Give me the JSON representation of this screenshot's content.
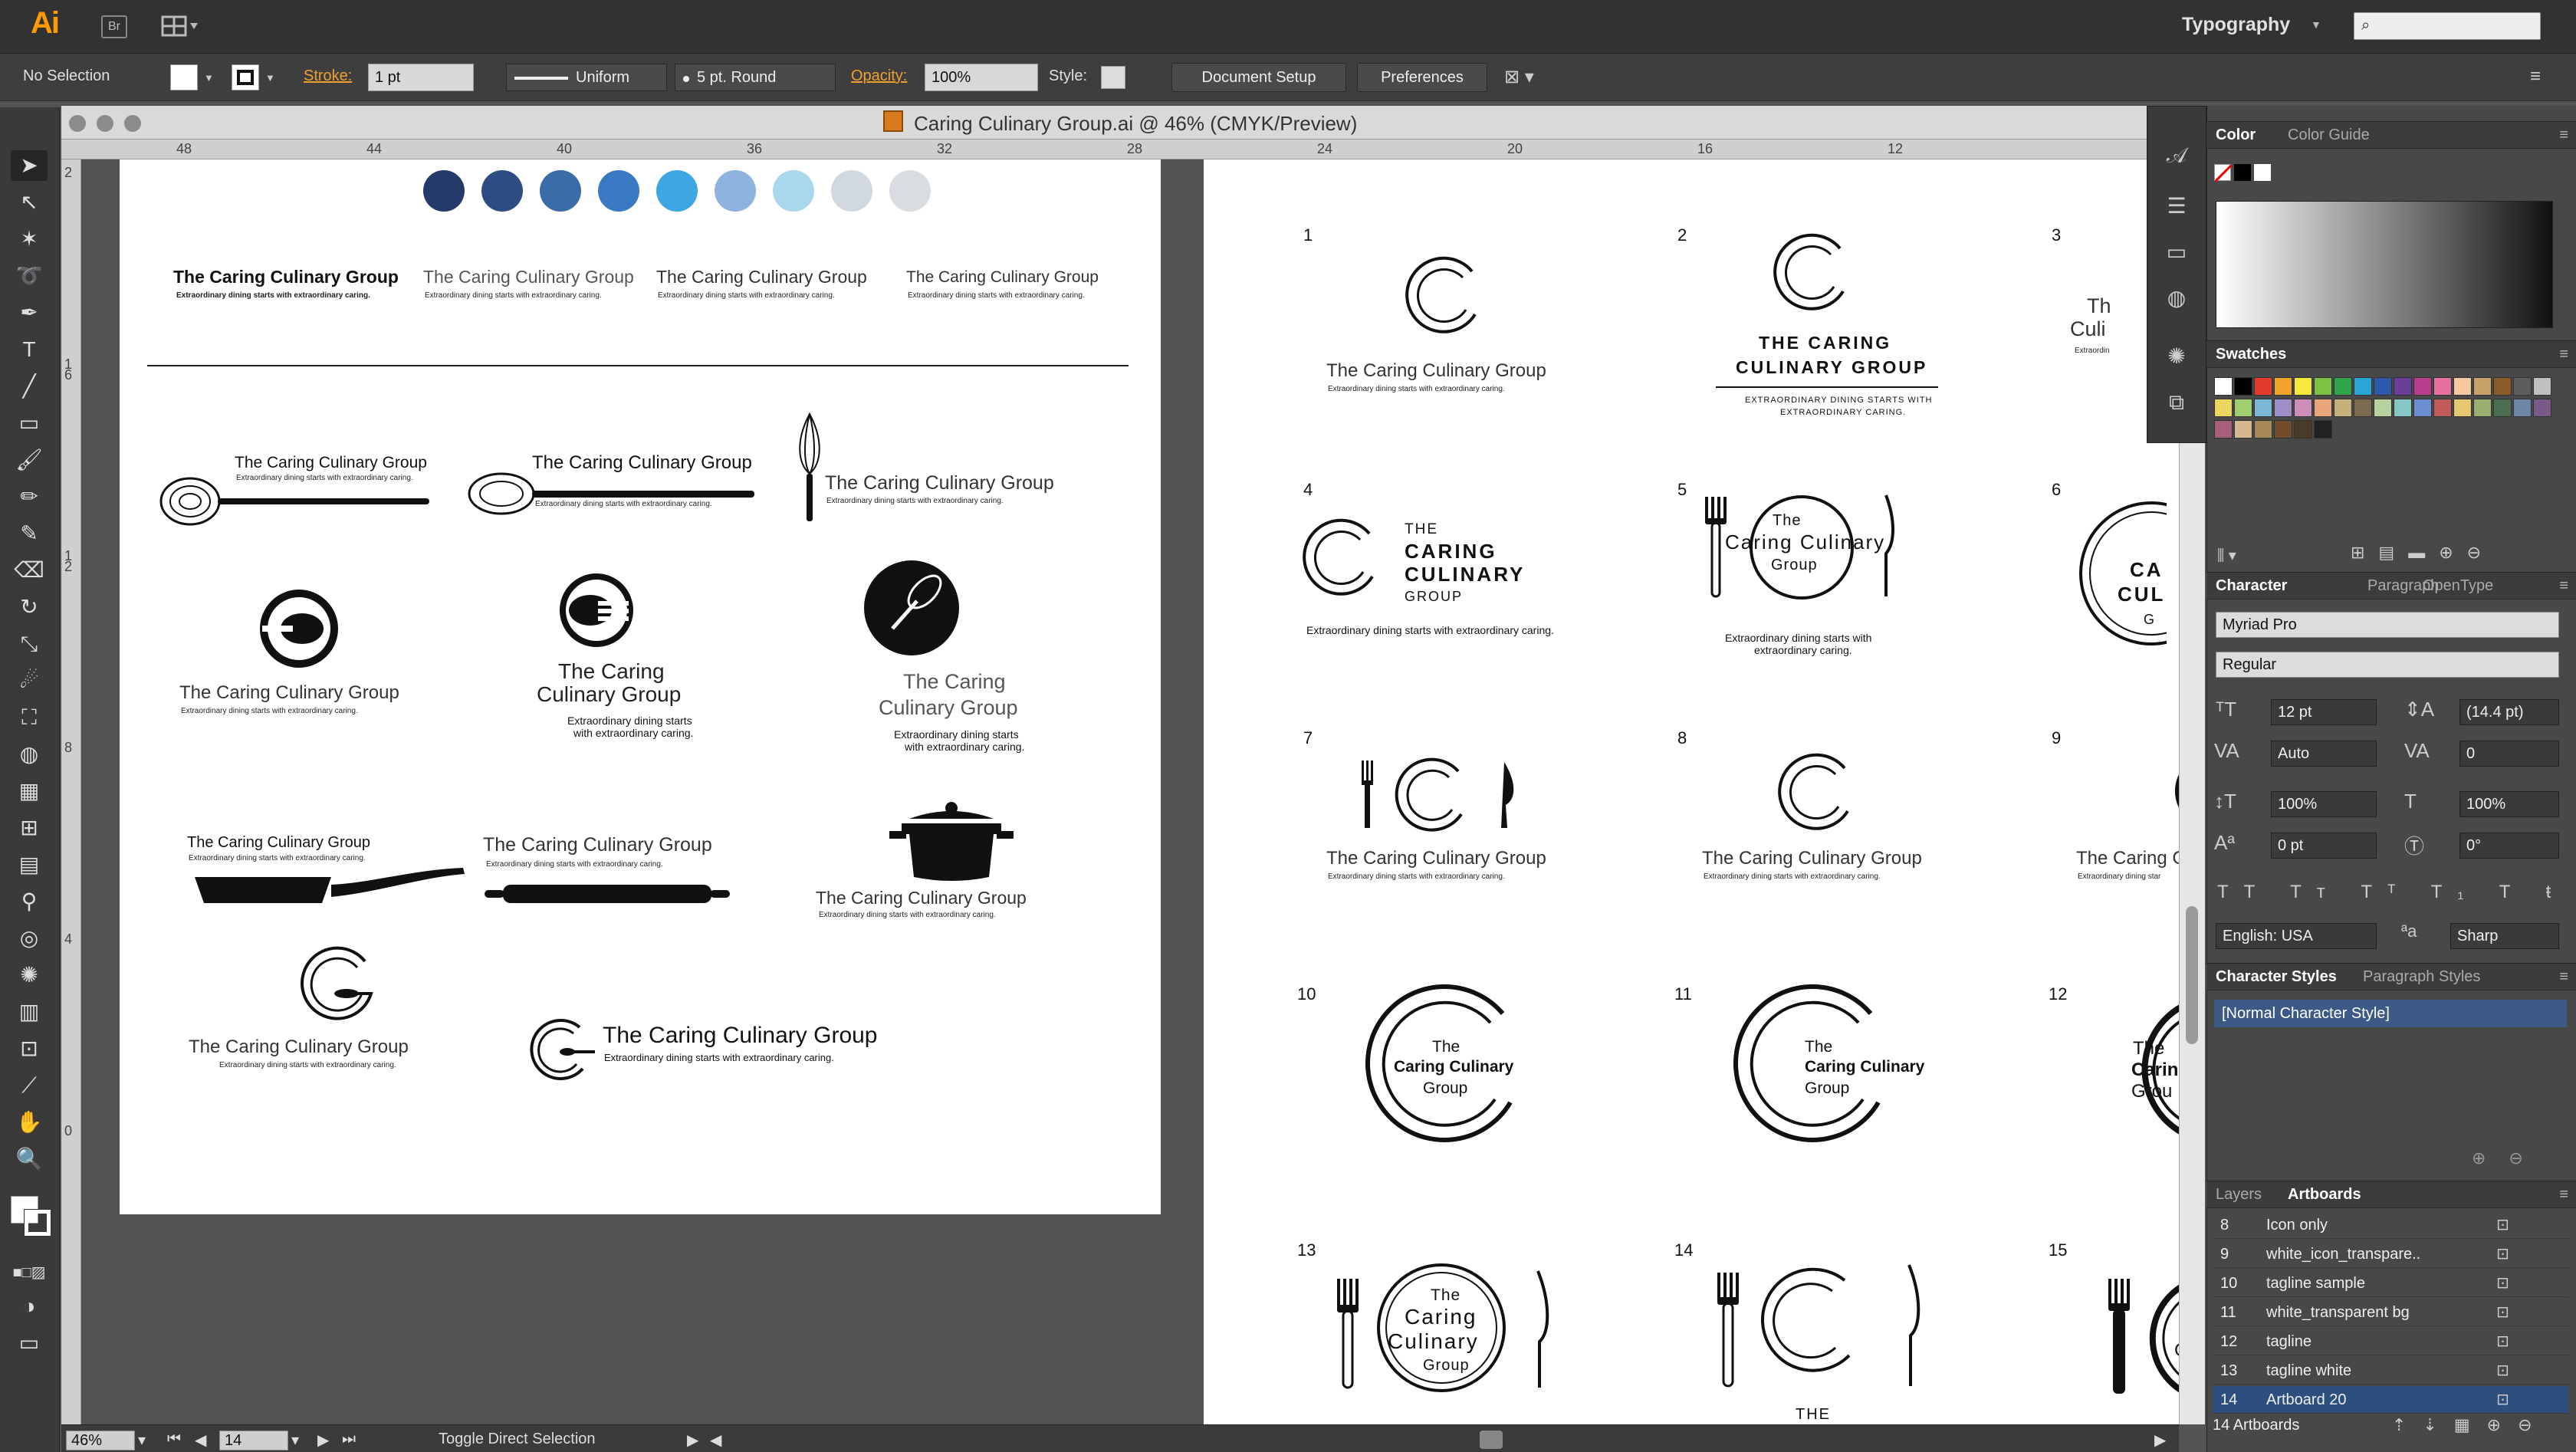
{
  "app": {
    "logo": "Ai",
    "bridge": "Br",
    "workspace": "Typography"
  },
  "control": {
    "selection": "No Selection",
    "stroke_label": "Stroke:",
    "stroke_value": "1 pt",
    "profile": "Uniform",
    "brush": "5 pt. Round",
    "opacity_label": "Opacity:",
    "opacity_value": "100%",
    "style_label": "Style:",
    "doc_setup": "Document Setup",
    "preferences": "Preferences"
  },
  "document": {
    "title": "Caring Culinary Group.ai @ 46% (CMYK/Preview)"
  },
  "ruler_h": [
    "48",
    "44",
    "40",
    "36",
    "32",
    "28",
    "24",
    "20",
    "16",
    "12"
  ],
  "ruler_v": [
    "2",
    "1 6",
    "1 2",
    "8",
    "4",
    "0"
  ],
  "palette": [
    "#233a6b",
    "#2f4d85",
    "#3a6ca8",
    "#3a7ac4",
    "#3ea6e2",
    "#8eb3de",
    "#a9d8ec",
    "#d2d8e0",
    "#d9dde2"
  ],
  "logos": {
    "name": "The Caring Culinary Group",
    "name_lines": [
      "The Caring",
      "Culinary Group"
    ],
    "tagline": "Extraordinary dining starts with extraordinary caring.",
    "tag_lines": [
      "Extraordinary dining starts",
      "with extraordinary caring."
    ],
    "tag_lines2": [
      "Extraordinary dining starts with",
      "extraordinary caring."
    ],
    "caps_the": "THE",
    "caps_caring": "CARING",
    "caps_culinary": "CULINARY",
    "caps_group": "GROUP",
    "caps_name": "THE CARING",
    "caps_name2": "CULINARY GROUP",
    "caps_tag": "EXTRAORDINARY DINING STARTS WITH",
    "caps_tag2": "EXTRAORDINARY CARING.",
    "mixed_the": "The",
    "mixed_caring": "Caring",
    "mixed_culinary": "Culinary",
    "mixed_group": "Group",
    "bold_line": "Caring Culinary",
    "partial_tag": "Extraordin",
    "partial_cu": "Culi",
    "partial_the": "Th",
    "partial_ca": "CA",
    "partial_cul": "CUL",
    "partial_g": "G",
    "partial_care": "The Caring C",
    "partial_tag2": "Extraordinary dining star",
    "partial_carin": "Carin",
    "partial_grou": "Grou",
    "partial_c": "C",
    "partial_cu2": "Cu",
    "partial_bottom": "THE"
  },
  "artboard_nums": [
    "1",
    "2",
    "3",
    "4",
    "5",
    "6",
    "7",
    "8",
    "9",
    "10",
    "11",
    "12",
    "13",
    "14",
    "15"
  ],
  "panels": {
    "color_tab": "Color",
    "color_guide_tab": "Color Guide",
    "swatches_tab": "Swatches",
    "char_tab": "Character",
    "para_tab": "Paragraph",
    "opentype_tab": "OpenType",
    "font": "Myriad Pro",
    "style": "Regular",
    "size": "12 pt",
    "leading": "(14.4 pt)",
    "kerning": "Auto",
    "tracking": "0",
    "vscale": "100%",
    "hscale": "100%",
    "baseline": "0 pt",
    "rotation": "0°",
    "language": "English: USA",
    "aa": "Sharp",
    "char_styles_tab": "Character Styles",
    "para_styles_tab": "Paragraph Styles",
    "normal_style": "[Normal Character Style]",
    "layers_tab": "Layers",
    "artboards_tab": "Artboards",
    "artboards_count": "14 Artboards"
  },
  "artboards": [
    {
      "n": "8",
      "name": "Icon only"
    },
    {
      "n": "9",
      "name": "white_icon_transpare.."
    },
    {
      "n": "10",
      "name": "tagline sample"
    },
    {
      "n": "11",
      "name": "white_transparent bg"
    },
    {
      "n": "12",
      "name": "tagline"
    },
    {
      "n": "13",
      "name": "tagline white"
    },
    {
      "n": "14",
      "name": "Artboard 20"
    }
  ],
  "status": {
    "zoom": "46%",
    "artboard": "14",
    "tool": "Toggle Direct Selection"
  },
  "swatch_colors": [
    "#ffffff",
    "#000000",
    "#e23b2e",
    "#f1a52a",
    "#f6e93b",
    "#7cc242",
    "#2da44a",
    "#2aa5d8",
    "#2b5aa8",
    "#6a3d98",
    "#b73c8e",
    "#e76fa0",
    "#f5c8a0",
    "#c7a26a",
    "#8a5a2b",
    "#5d5d5d",
    "#c0c0c0",
    "#ecd65b",
    "#9fcf6f",
    "#7bb8d6",
    "#9e8ec8",
    "#c98fb8",
    "#e9a67a",
    "#c4b07a",
    "#7a6a4e",
    "#b5d2a0",
    "#85c7c2",
    "#6b8fd0",
    "#c25b5b",
    "#e5c870",
    "#9ab070",
    "#4e6e52",
    "#6e86a8",
    "#7a5a88",
    "#a85f7c",
    "#d7b88e",
    "#a88a58",
    "#704e2c",
    "#4a3a2a",
    "#222222"
  ]
}
